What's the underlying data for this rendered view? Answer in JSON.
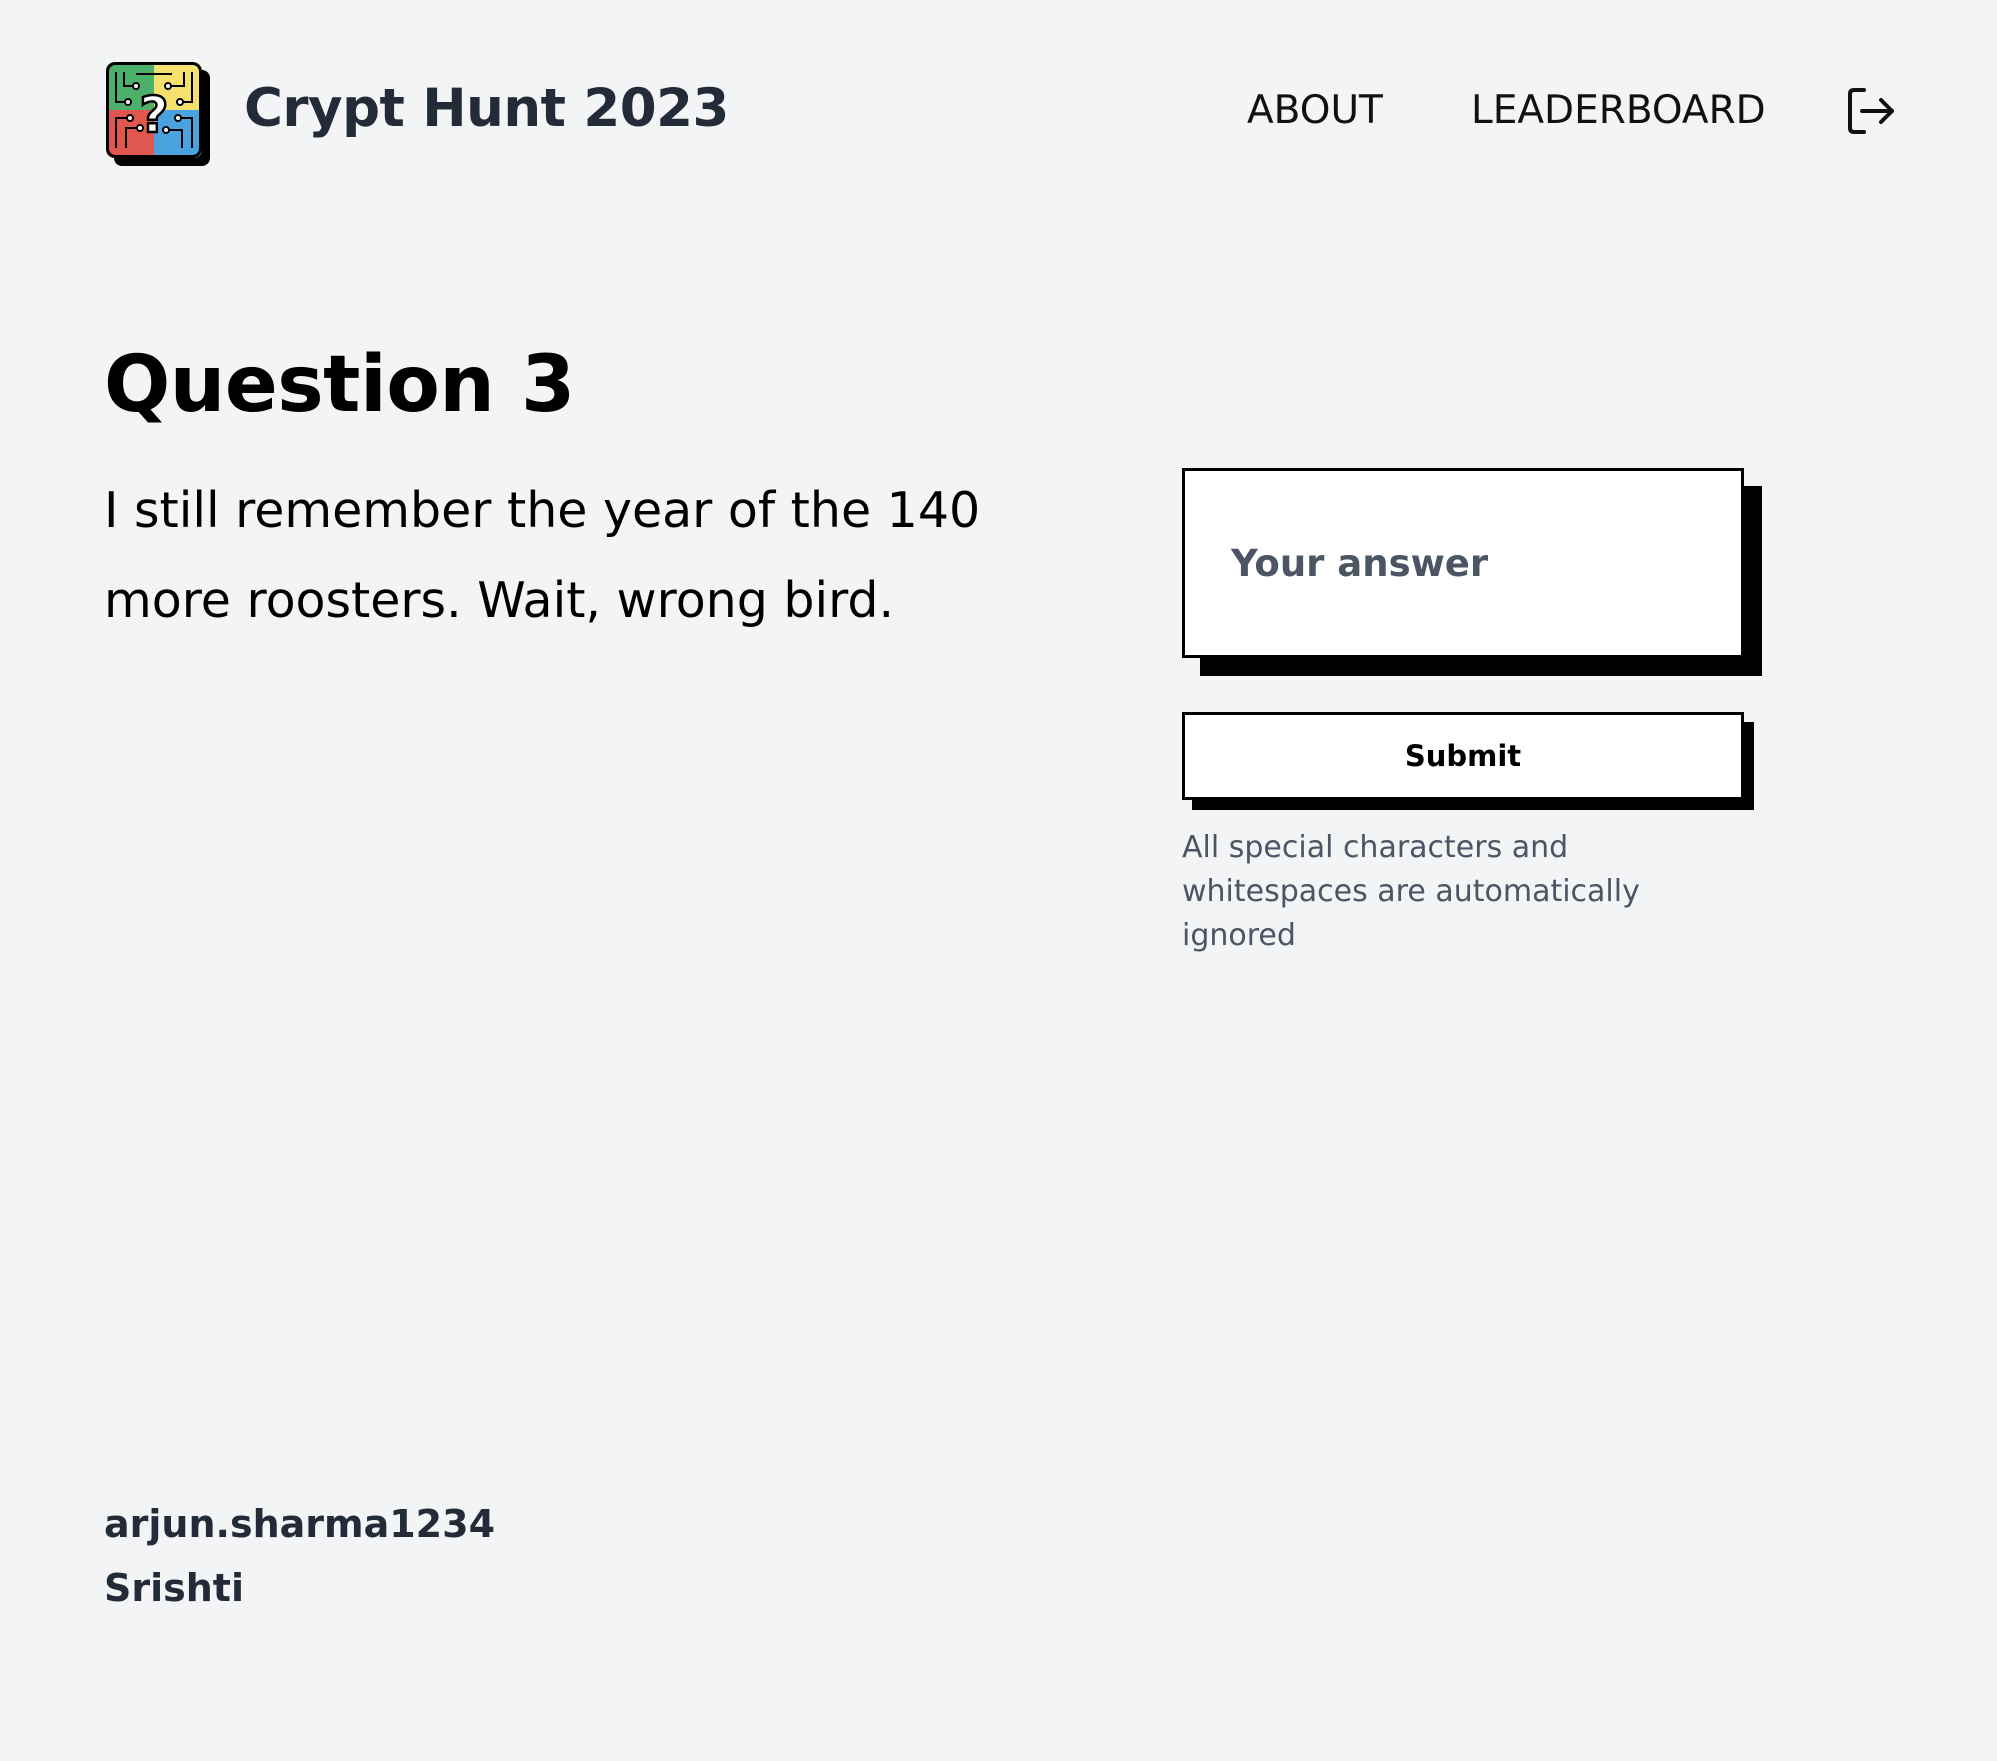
{
  "header": {
    "site_title": "Crypt Hunt 2023",
    "logo_icon": "circuit-question-logo-icon",
    "nav": {
      "about": "ABOUT",
      "leaderboard": "LEADERBOARD"
    },
    "logout_icon": "logout-icon"
  },
  "question": {
    "title": "Question 3",
    "body": "I still remember the year of the 140 more roosters. Wait, wrong bird."
  },
  "answer_form": {
    "placeholder": "Your answer",
    "value": "",
    "submit_label": "Submit",
    "hint": "All special characters and whitespaces are automatically ignored"
  },
  "user": {
    "username": "arjun.sharma1234",
    "name": "Srishti"
  },
  "colors": {
    "background": "#f3f4f6",
    "logo_green": "#4caf6a",
    "logo_yellow": "#f5e06e",
    "logo_red": "#e0574f",
    "logo_blue": "#4aa3df",
    "shadow": "#000000",
    "muted_text": "#4b5563"
  }
}
